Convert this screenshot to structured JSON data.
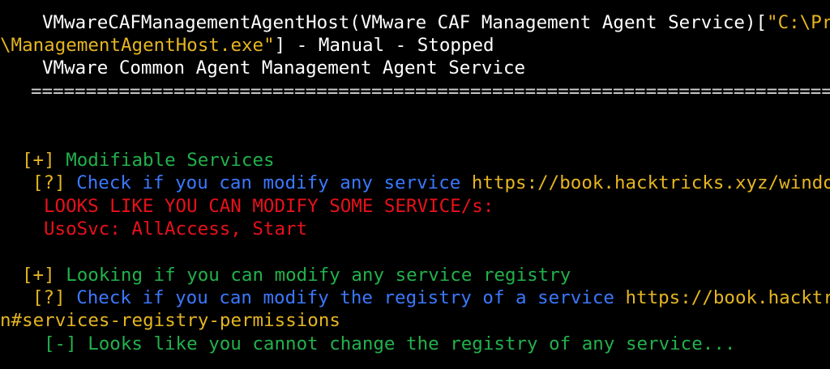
{
  "terminal": {
    "service_entry": {
      "name": "VMwareCAFManagementAgentHost(VMware CAF Management Agent Service)",
      "path_open": "[",
      "path_head": "\"C:\\Pr",
      "path_tail": "\\ManagementAgentHost.exe\"",
      "path_close": "]",
      "status": " - Manual - Stopped",
      "description": "VMware Common Agent Management Agent Service",
      "separator": "================================================================================================="
    },
    "modifiable_services": {
      "marker": "[+]",
      "title": "Modifiable Services",
      "hint_marker": "[?]",
      "hint_text": "Check if you can modify any service",
      "hint_link": "https://book.hacktricks.xyz/windo",
      "warning": "LOOKS LIKE YOU CAN MODIFY SOME SERVICE/s:",
      "finding": "UsoSvc: AllAccess, Start"
    },
    "service_registry": {
      "marker": "[+]",
      "title": "Looking if you can modify any service registry",
      "hint_marker": "[?]",
      "hint_text": "Check if you can modify the registry of a service",
      "hint_link": "https://book.hacktr",
      "hint_link_cont": "n#services-registry-permissions",
      "result_marker": "[-]",
      "result_text": "Looks like you cannot change the registry of any service..."
    },
    "colors": {
      "background": "#000000",
      "text": "#ffffff",
      "green": "#22b14c",
      "yellow": "#e5b521",
      "blue": "#3b78ff",
      "red": "#e8111a"
    }
  }
}
